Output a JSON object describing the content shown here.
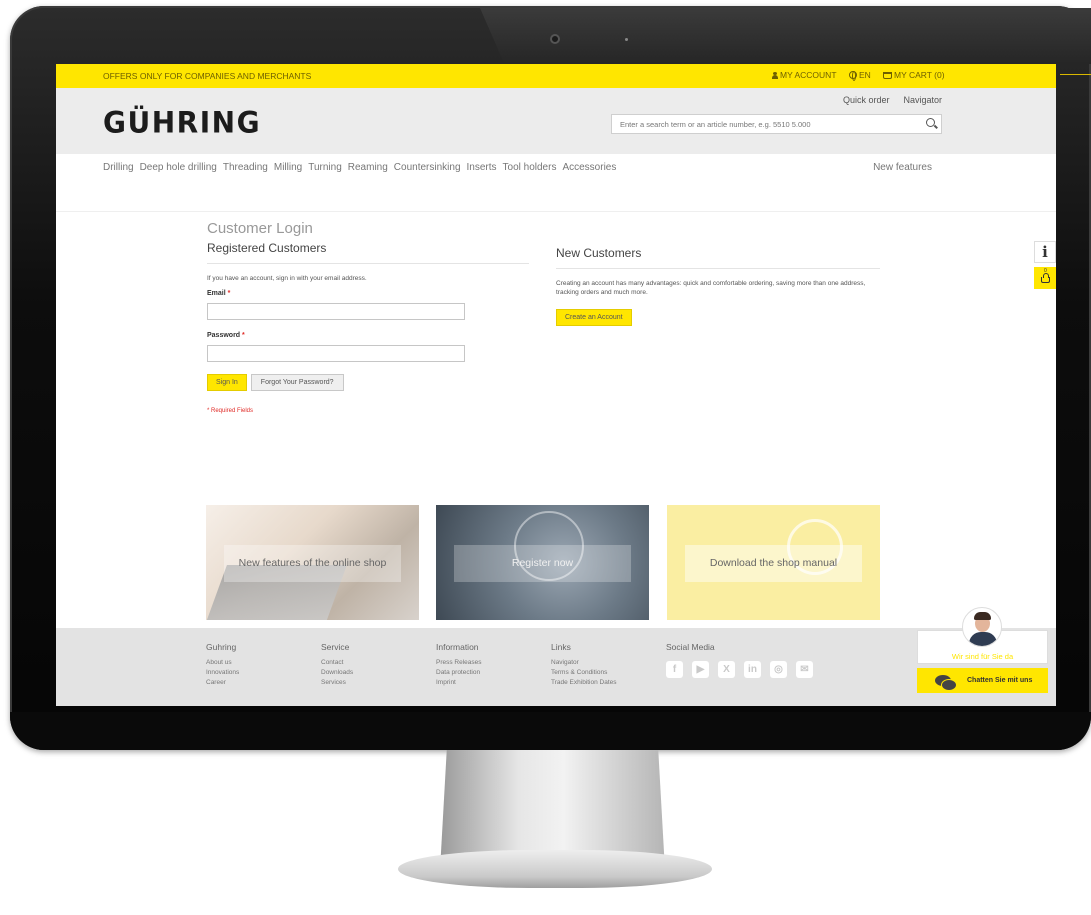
{
  "topbar": {
    "offer": "OFFERS ONLY FOR COMPANIES AND MERCHANTS",
    "my_account": "MY ACCOUNT",
    "language": "EN",
    "cart": "MY CART (0)"
  },
  "header": {
    "logo": "GÜHRING",
    "quick_order": "Quick order",
    "navigator": "Navigator",
    "search_placeholder": "Enter a search term or an article number, e.g. 5510 5.000"
  },
  "nav": {
    "items": [
      "Drilling",
      "Deep hole drilling",
      "Threading",
      "Milling",
      "Turning",
      "Reaming",
      "Countersinking",
      "Inserts",
      "Tool holders",
      "Accessories"
    ],
    "new_features": "New features"
  },
  "login": {
    "title": "Customer Login",
    "registered_heading": "Registered Customers",
    "intro": "If you have an account, sign in with your email address.",
    "email_label": "Email",
    "password_label": "Password",
    "required_star": "*",
    "sign_in": "Sign In",
    "forgot": "Forgot Your Password?",
    "required_note": "* Required Fields"
  },
  "new_customers": {
    "heading": "New Customers",
    "text": "Creating an account has many advantages: quick and comfortable ordering, saving more than one address, tracking orders and much more.",
    "create_button": "Create an Account"
  },
  "sidebar": {
    "info_glyph": "i",
    "basket_count": "0"
  },
  "banners": [
    {
      "caption": "New features of the online shop"
    },
    {
      "caption": "Register now"
    },
    {
      "caption": "Download the shop manual"
    }
  ],
  "footer": {
    "columns": [
      {
        "heading": "Guhring",
        "links": [
          "About us",
          "Innovations",
          "Career"
        ]
      },
      {
        "heading": "Service",
        "links": [
          "Contact",
          "Downloads",
          "Services"
        ]
      },
      {
        "heading": "Information",
        "links": [
          "Press Releases",
          "Data protection",
          "Imprint"
        ]
      },
      {
        "heading": "Links",
        "links": [
          "Navigator",
          "Terms & Conditions",
          "Trade Exhibition Dates"
        ]
      }
    ],
    "social_heading": "Social Media",
    "social_icons": [
      "facebook-icon",
      "youtube-icon",
      "xing-icon",
      "linkedin-icon",
      "instagram-icon",
      "email-icon"
    ],
    "social_glyphs": [
      "f",
      "▶",
      "X",
      "in",
      "◎",
      "✉"
    ]
  },
  "chat": {
    "greeting": "Wir sind für Sie da",
    "button": "Chatten Sie mit uns"
  },
  "colors": {
    "brand_yellow": "#ffe600",
    "error_red": "#e02b27"
  }
}
